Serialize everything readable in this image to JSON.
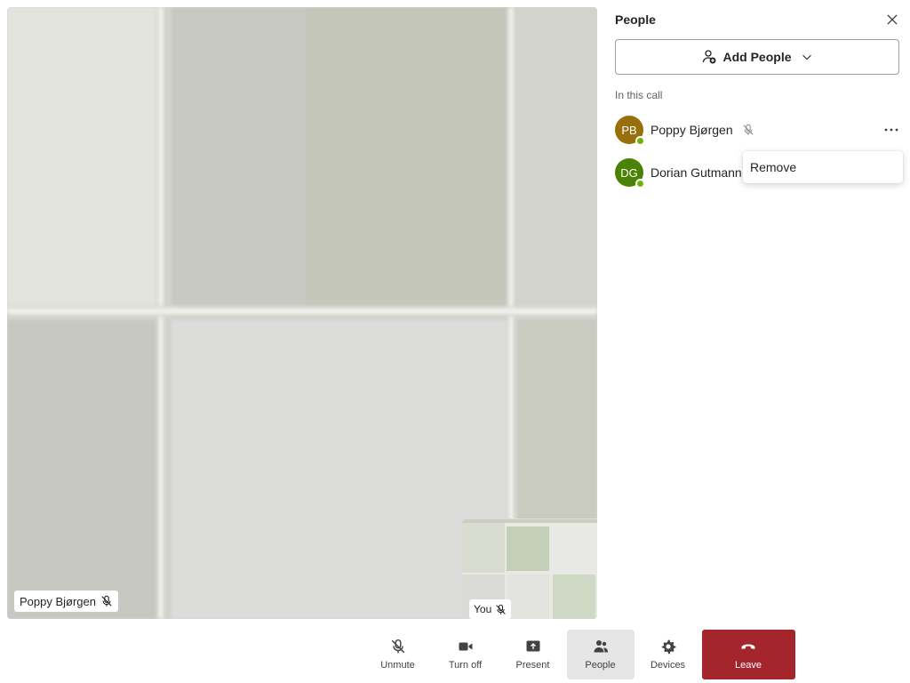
{
  "stage": {
    "participant_name": "Poppy Bjørgen"
  },
  "self_view": {
    "label": "You"
  },
  "toolbar": {
    "unmute": "Unmute",
    "turn_off": "Turn off",
    "present": "Present",
    "people": "People",
    "devices": "Devices",
    "leave": "Leave"
  },
  "panel": {
    "title": "People",
    "add_people": "Add People",
    "section": "In this call",
    "participants": [
      {
        "initials": "PB",
        "name": "Poppy Bjørgen",
        "avatar_color": "#986f0b",
        "muted": true
      },
      {
        "initials": "DG",
        "name": "Dorian Gutmann",
        "avatar_color": "#498205",
        "muted": false
      }
    ]
  },
  "context_menu": {
    "remove": "Remove"
  },
  "colors": {
    "leave": "#a4262c",
    "presence": "#6bb700",
    "active_tab": "#e6e6e6"
  },
  "icons": [
    "mic-off-icon",
    "camera-icon",
    "present-icon",
    "people-icon",
    "gear-icon",
    "hang-up-icon",
    "close-icon",
    "add-person-icon",
    "chevron-down-icon",
    "more-icon"
  ]
}
